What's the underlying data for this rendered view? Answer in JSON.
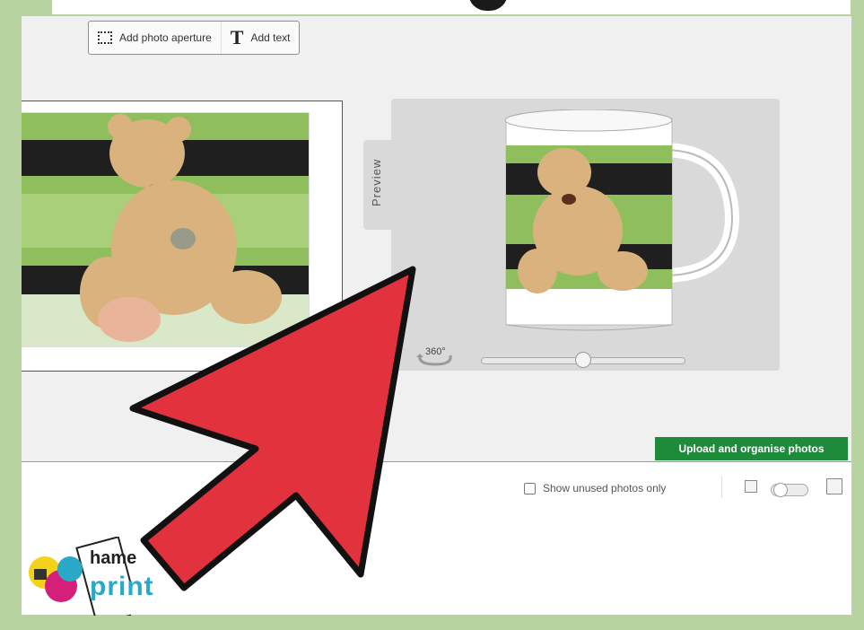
{
  "toolbar": {
    "add_photo_aperture": "Add photo aperture",
    "add_text": "Add text"
  },
  "preview": {
    "tab_label": "Preview",
    "rotate_label": "360°",
    "rotation_slider_value": 0.5
  },
  "actions": {
    "upload_button": "Upload and organise photos"
  },
  "photo_panel": {
    "show_unused_label": "Show unused photos only",
    "show_unused_checked": false
  },
  "logo": {
    "name_fragment": "hame",
    "print_word": "print"
  },
  "colors": {
    "frame": "#b7d39f",
    "upload_button": "#1e8b3a",
    "arrow_fill": "#e2323e"
  },
  "icons": [
    "aperture-icon",
    "text-icon",
    "rotate-360-icon",
    "thumbnail-small-icon",
    "thumbnail-large-icon"
  ]
}
